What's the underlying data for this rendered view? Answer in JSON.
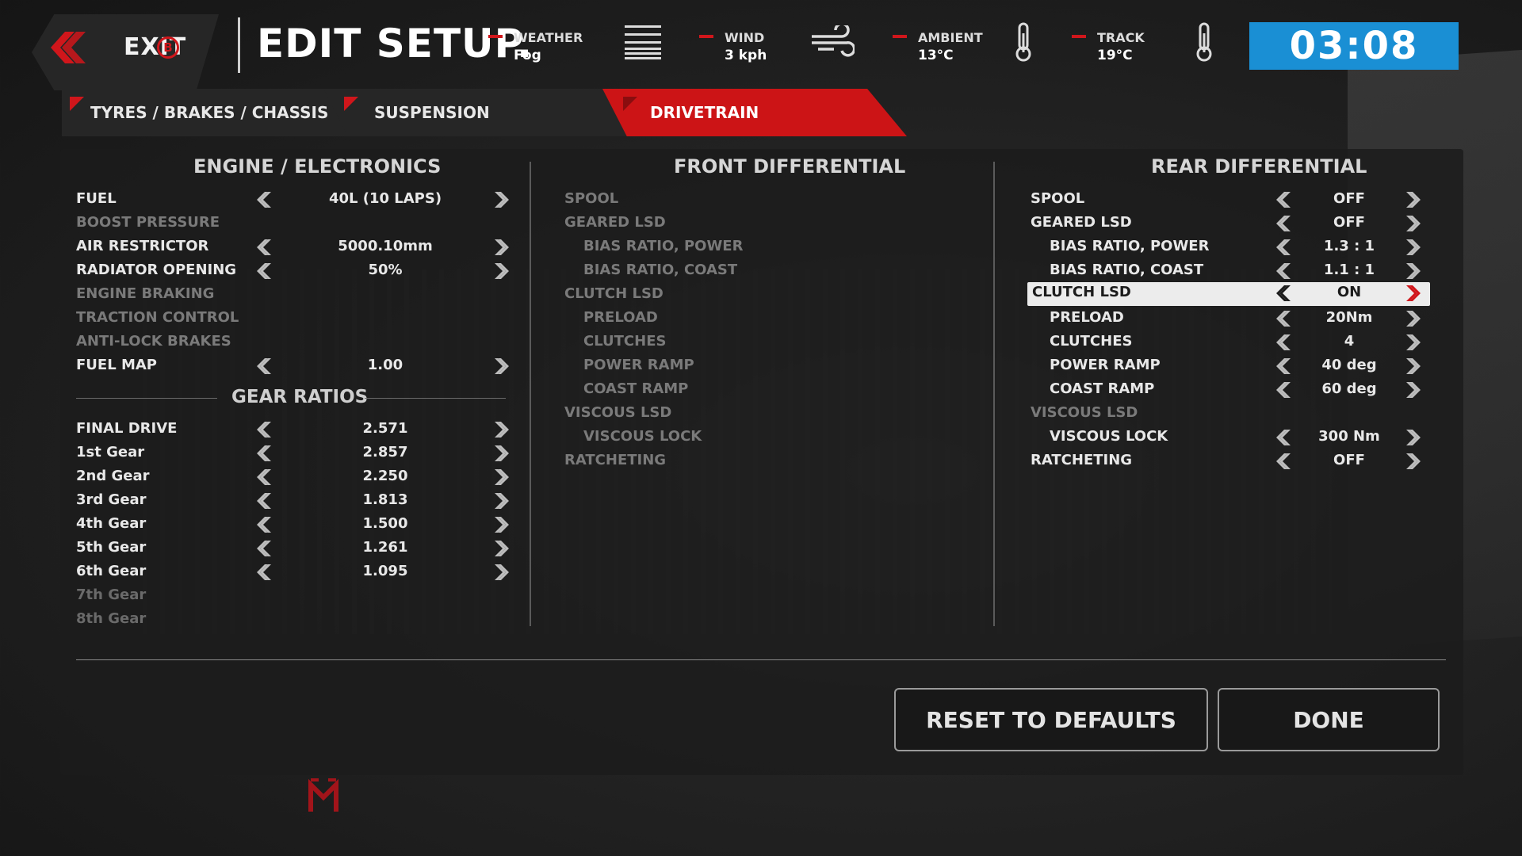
{
  "header": {
    "exit_label": "EXIT",
    "exit_key": "B",
    "title": "EDIT SETUP.",
    "stats": [
      {
        "label": "WEATHER",
        "value": "Fog",
        "icon": "fog-icon"
      },
      {
        "label": "WIND",
        "value": "3 kph",
        "icon": "wind-icon"
      },
      {
        "label": "AMBIENT",
        "value": "13°C",
        "icon": "thermometer-icon"
      },
      {
        "label": "TRACK",
        "value": "19°C",
        "icon": "thermometer-icon"
      }
    ],
    "timer": "03:08"
  },
  "tabs": [
    {
      "label": "TYRES / BRAKES / CHASSIS",
      "active": false
    },
    {
      "label": "SUSPENSION",
      "active": false
    },
    {
      "label": "DRIVETRAIN",
      "active": true
    }
  ],
  "engine": {
    "title": "ENGINE / ELECTRONICS",
    "rows": [
      {
        "label": "FUEL",
        "value": "40L (10 LAPS)"
      },
      {
        "label": "BOOST PRESSURE",
        "value": ""
      },
      {
        "label": "AIR RESTRICTOR",
        "value": "5000.10mm"
      },
      {
        "label": "RADIATOR OPENING",
        "value": "50%"
      },
      {
        "label": "ENGINE BRAKING",
        "value": ""
      },
      {
        "label": "TRACTION CONTROL",
        "value": ""
      },
      {
        "label": "ANTI-LOCK BRAKES",
        "value": ""
      },
      {
        "label": "FUEL MAP",
        "value": "1.00"
      }
    ]
  },
  "gears": {
    "title": "GEAR RATIOS",
    "rows": [
      {
        "label": "FINAL DRIVE",
        "value": "2.571"
      },
      {
        "label": "1st Gear",
        "value": "2.857"
      },
      {
        "label": "2nd Gear",
        "value": "2.250"
      },
      {
        "label": "3rd Gear",
        "value": "1.813"
      },
      {
        "label": "4th Gear",
        "value": "1.500"
      },
      {
        "label": "5th Gear",
        "value": "1.261"
      },
      {
        "label": "6th Gear",
        "value": "1.095"
      },
      {
        "label": "7th Gear",
        "value": ""
      },
      {
        "label": "8th Gear",
        "value": ""
      }
    ]
  },
  "front_diff": {
    "title": "FRONT DIFFERENTIAL",
    "rows": [
      {
        "label": "SPOOL"
      },
      {
        "label": "GEARED LSD"
      },
      {
        "label": "BIAS RATIO, POWER"
      },
      {
        "label": "BIAS RATIO, COAST"
      },
      {
        "label": "CLUTCH LSD"
      },
      {
        "label": "PRELOAD"
      },
      {
        "label": "CLUTCHES"
      },
      {
        "label": "POWER RAMP"
      },
      {
        "label": "COAST RAMP"
      },
      {
        "label": "VISCOUS LSD"
      },
      {
        "label": "VISCOUS LOCK"
      },
      {
        "label": "RATCHETING"
      }
    ]
  },
  "rear_diff": {
    "title": "REAR DIFFERENTIAL",
    "rows": [
      {
        "label": "SPOOL",
        "value": "OFF"
      },
      {
        "label": "GEARED LSD",
        "value": "OFF"
      },
      {
        "label": "BIAS RATIO, POWER",
        "value": "1.3 : 1"
      },
      {
        "label": "BIAS RATIO, COAST",
        "value": "1.1 : 1"
      },
      {
        "label": "CLUTCH LSD",
        "value": "ON"
      },
      {
        "label": "PRELOAD",
        "value": "20Nm"
      },
      {
        "label": "CLUTCHES",
        "value": "4"
      },
      {
        "label": "POWER RAMP",
        "value": "40 deg"
      },
      {
        "label": "COAST RAMP",
        "value": "60 deg"
      },
      {
        "label": "VISCOUS LSD",
        "value": ""
      },
      {
        "label": "VISCOUS LOCK",
        "value": "300 Nm"
      },
      {
        "label": "RATCHETING",
        "value": "OFF"
      }
    ]
  },
  "footer": {
    "reset_label": "RESET TO DEFAULTS",
    "done_label": "DONE"
  },
  "colors": {
    "accent_red": "#cc1416",
    "timer_blue": "#1a8fd4",
    "selected_row": "#ececec"
  }
}
